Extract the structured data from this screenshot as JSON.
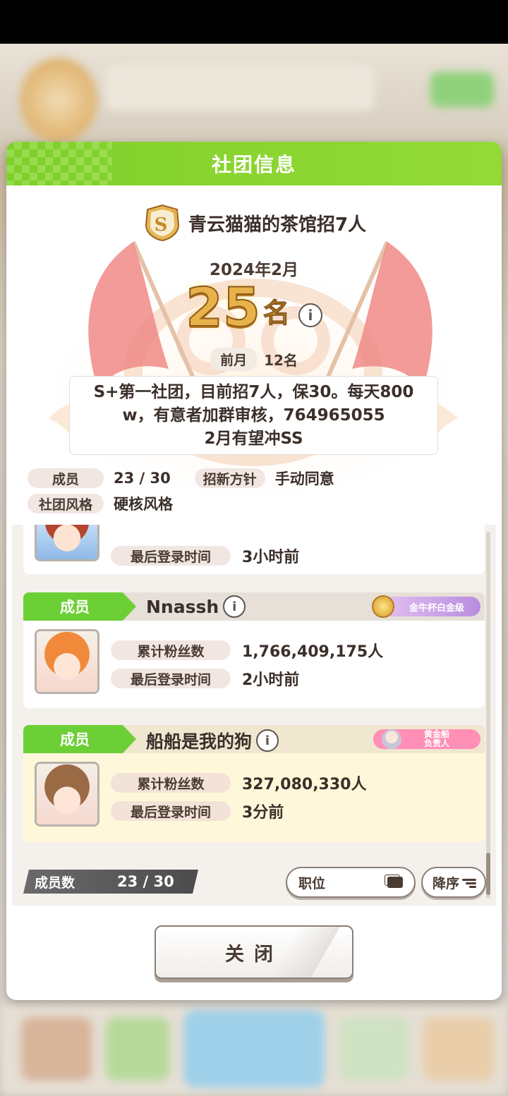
{
  "dialog": {
    "title": "社团信息",
    "club_name": "青云猫猫的茶馆招7人",
    "rank_grade": "S+",
    "month": "2024年2月",
    "rank_number": "25",
    "rank_unit": "名",
    "prev_label": "前月",
    "prev_value": "12名",
    "description": [
      "S+第一社团，目前招7人，保30。每天800",
      "w，有意者加群审核，764965055",
      "2月有望冲SS"
    ],
    "meta": {
      "members_label": "成员",
      "members_value": "23 / 30",
      "policy_label": "招新方针",
      "policy_value": "手动同意",
      "style_label": "社团风格",
      "style_value": "硬核风格"
    },
    "members": [
      {
        "role": "",
        "name": "",
        "fans_label": "",
        "fans": "",
        "login_label": "最后登录时间",
        "last_login": "3小时前"
      },
      {
        "role": "成员",
        "name": "Nnassh",
        "badge": "金牛杯白金级",
        "fans_label": "累计粉丝数",
        "fans": "1,766,409,175人",
        "login_label": "最后登录时间",
        "last_login": "2小时前"
      },
      {
        "role": "成员",
        "name": "船船是我的狗",
        "badge_line1": "黄金船",
        "badge_line2": "负责人",
        "fans_label": "累计粉丝数",
        "fans": "327,080,330人",
        "login_label": "最后登录时间",
        "last_login": "3分前"
      }
    ],
    "footer": {
      "count_label": "成员数",
      "count_value": "23 / 30",
      "sort_position": "职位",
      "sort_order": "降序"
    },
    "close_label": "关闭"
  },
  "colors": {
    "header_green": "#8bd531",
    "tag_green": "#6ccf35",
    "rank_gold": "#e8b14a",
    "flag_red": "#f08a86",
    "self_highlight": "#fff7d9"
  },
  "icons": [
    "info-icon",
    "rank-badge-icon",
    "medal-icon",
    "position-icon",
    "sort-lines-icon"
  ]
}
